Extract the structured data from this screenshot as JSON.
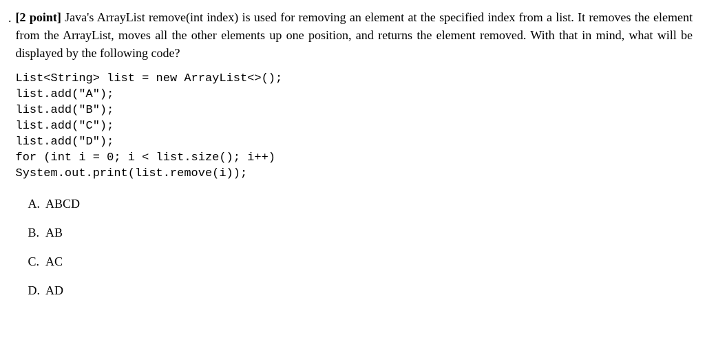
{
  "question": {
    "marker": ".",
    "points_label": "[2 point]",
    "prompt_text": "Java's ArrayList remove(int index) is used for removing an element at the specified index from a list. It removes the element from the ArrayList, moves all the other elements up one position, and returns the element removed. With that in mind, what will be displayed by the following code?"
  },
  "code_lines": {
    "l1a": "List<String> list = ",
    "l1b": "new",
    "l1c": " ArrayList<>();",
    "l2": "list.add(\"A\");",
    "l3": "list.add(\"B\");",
    "l4": "list.add(\"C\");",
    "l5": "list.add(\"D\");",
    "l6a": "for",
    "l6b": " (",
    "l6c": "int",
    "l6d": " i = 0; i < list.size(); i++)",
    "l7": "System.out.print(list.remove(i));"
  },
  "choices": [
    {
      "label": "A.",
      "text": "ABCD"
    },
    {
      "label": "B.",
      "text": "AB"
    },
    {
      "label": "C.",
      "text": "AC"
    },
    {
      "label": "D.",
      "text": "AD"
    }
  ]
}
